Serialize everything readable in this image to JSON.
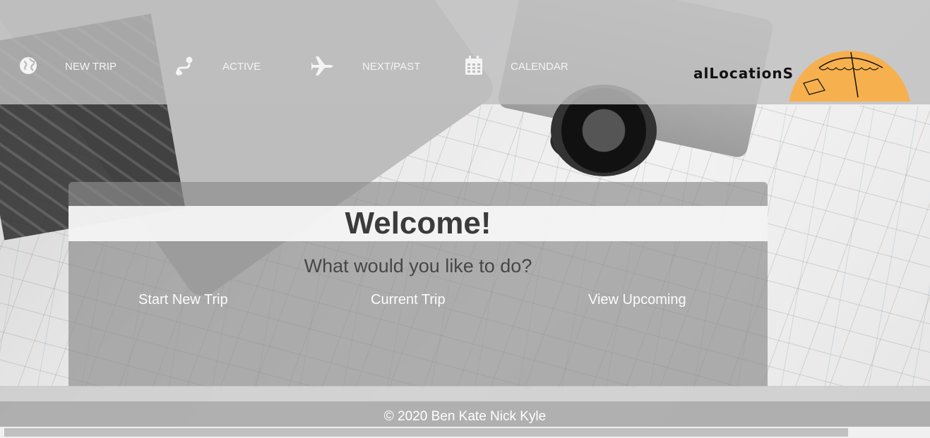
{
  "nav": {
    "items": [
      {
        "label": "NEW TRIP",
        "icon": "globe-icon"
      },
      {
        "label": "ACTIVE",
        "icon": "route-icon"
      },
      {
        "label": "NEXT/PAST",
        "icon": "airplane-icon"
      },
      {
        "label": "CALENDAR",
        "icon": "calendar-icon"
      }
    ],
    "logo_text": "alLocationS"
  },
  "panel": {
    "title": "Welcome!",
    "prompt": "What would you like to do?",
    "actions": [
      "Start New Trip",
      "Current Trip",
      "View Upcoming"
    ]
  },
  "footer": {
    "text": "© 2020 Ben Kate Nick Kyle"
  },
  "colors": {
    "logo_sun": "#f6b04d",
    "nav_bg": "#bebec0",
    "panel_bg": "#8c8c8c"
  }
}
